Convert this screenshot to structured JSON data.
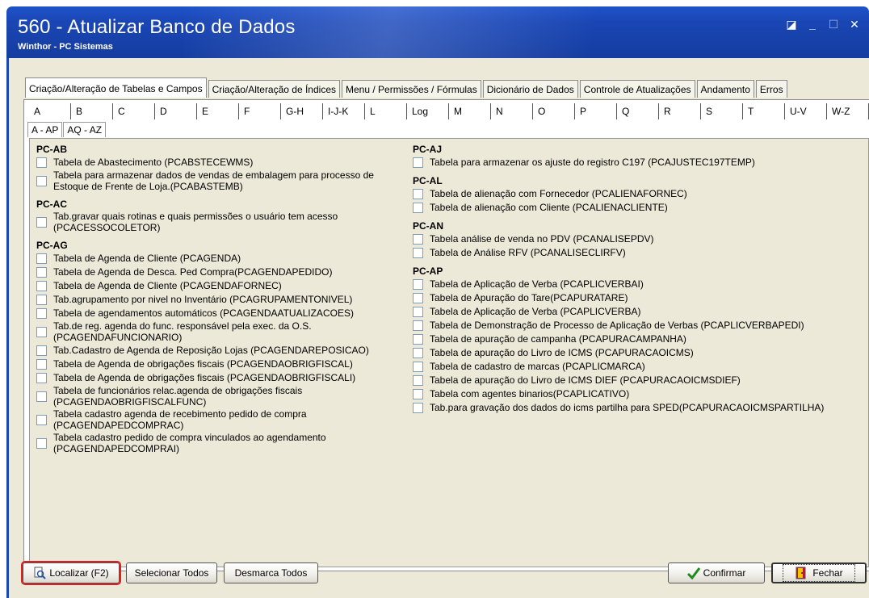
{
  "window": {
    "title": "560 - Atualizar Banco de Dados",
    "subtitle": "Winthor - PC Sistemas",
    "colors": {
      "titlebar": "#1a46b4",
      "body": "#ece9d8",
      "highlight": "#e02020"
    }
  },
  "tabs": [
    {
      "label": "Criação/Alteração de Tabelas e Campos",
      "active": true
    },
    {
      "label": "Criação/Alteração de Índices"
    },
    {
      "label": "Menu / Permissões / Fórmulas"
    },
    {
      "label": "Dicionário de Dados"
    },
    {
      "label": "Controle de Atualizações"
    },
    {
      "label": "Andamento"
    },
    {
      "label": "Erros"
    }
  ],
  "letters": [
    "A",
    "B",
    "C",
    "D",
    "E",
    "F",
    "G-H",
    "I-J-K",
    "L",
    "Log",
    "M",
    "N",
    "O",
    "P",
    "Q",
    "R",
    "S",
    "T",
    "U-V",
    "W-Z"
  ],
  "subtabs": [
    {
      "label": "A - AP",
      "active": true
    },
    {
      "label": "AQ - AZ"
    }
  ],
  "left_groups": [
    {
      "title": "PC-AB",
      "items": [
        "Tabela de Abastecimento (PCABSTECEWMS)",
        "Tabela para armazenar dados de vendas de embalagem para processo de\nEstoque de Frente de Loja.(PCABASTEMB)"
      ]
    },
    {
      "title": "PC-AC",
      "items": [
        "Tab.gravar quais rotinas e quais permissões o usuário tem acesso\n(PCACESSOCOLETOR)"
      ]
    },
    {
      "title": "PC-AG",
      "items": [
        "Tabela  de Agenda de Cliente (PCAGENDA)",
        "Tabela  de Agenda de Desca. Ped Compra(PCAGENDAPEDIDO)",
        "Tabela  de Agenda de Cliente (PCAGENDAFORNEC)",
        "Tab.agrupamento por nivel no Inventário (PCAGRUPAMENTONIVEL)",
        "Tabela de agendamentos automáticos (PCAGENDAATUALIZACOES)",
        "Tab.de reg. agenda do func. responsável pela exec. da O.S.\n(PCAGENDAFUNCIONARIO)",
        "Tab.Cadastro de Agenda de Reposição Lojas (PCAGENDAREPOSICAO)",
        "Tabela de Agenda de obrigações fiscais (PCAGENDAOBRIGFISCAL)",
        "Tabela de Agenda de obrigações fiscais (PCAGENDAOBRIGFISCALI)",
        "Tabela de funcionários relac.agenda de obrigações fiscais\n(PCAGENDAOBRIGFISCALFUNC)",
        "Tabela cadastro agenda de recebimento pedido de compra\n(PCAGENDAPEDCOMPRAC)",
        "Tabela cadastro pedido de compra vinculados ao agendamento\n(PCAGENDAPEDCOMPRAI)"
      ]
    }
  ],
  "right_groups": [
    {
      "title": "PC-AJ",
      "items": [
        "Tabela para armazenar os ajuste do registro C197 (PCAJUSTEC197TEMP)"
      ]
    },
    {
      "title": "PC-AL",
      "items": [
        "Tabela de alienação com Fornecedor (PCALIENAFORNEC)",
        "Tabela de alienação com Cliente (PCALIENACLIENTE)"
      ]
    },
    {
      "title": "PC-AN",
      "items": [
        "Tabela análise de venda no PDV (PCANALISEPDV)",
        "Tabela de Análise RFV (PCANALISECLIRFV)"
      ]
    },
    {
      "title": "PC-AP",
      "items": [
        "Tabela de Aplicação de Verba (PCAPLICVERBAI)",
        "Tabela de Apuração do Tare(PCAPURATARE)",
        "Tabela de Aplicação de Verba (PCAPLICVERBA)",
        "Tabela de Demonstração de Processo de Aplicação de Verbas (PCAPLICVERBAPEDI)",
        "Tabela de apuração de campanha (PCAPURACAMPANHA)",
        "Tabela de apuração do Livro de ICMS (PCAPURACAOICMS)",
        "Tabela de cadastro de marcas (PCAPLICMARCA)",
        "Tabela de apuração do Livro de ICMS DIEF (PCAPURACAOICMSDIEF)",
        "Tabela com agentes binarios(PCAPLICATIVO)",
        "Tab.para gravação dos dados do icms partilha para SPED(PCAPURACAOICMSPARTILHA)"
      ]
    }
  ],
  "buttons": {
    "find_label": "Localizar (F2)",
    "select_all_label": "Selecionar Todos",
    "unmark_all_label": "Desmarca Todos",
    "confirm_label": "Confirmar",
    "close_label": "Fechar"
  }
}
